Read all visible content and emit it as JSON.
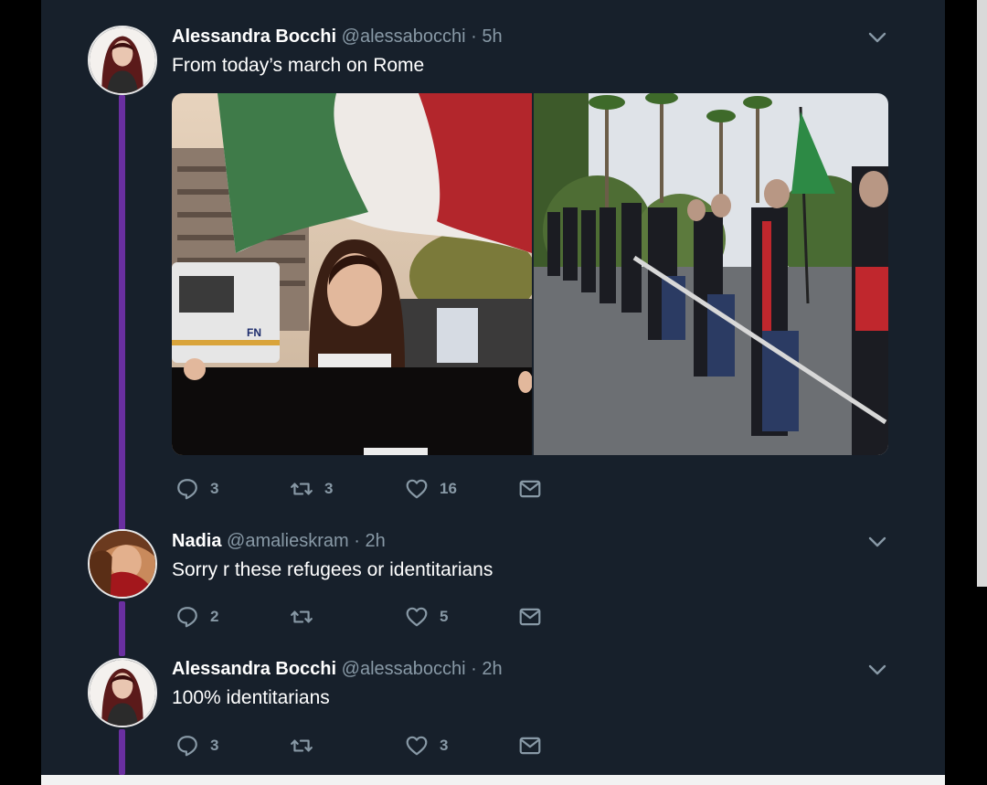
{
  "thread": [
    {
      "name": "Alessandra Bocchi",
      "handle": "@alessabocchi",
      "dot": "·",
      "time": "5h",
      "text": "From today’s march on Rome",
      "actions": {
        "reply": "3",
        "retweet": "3",
        "like": "16"
      }
    },
    {
      "name": "Nadia",
      "handle": "@amalieskram",
      "dot": "·",
      "time": "2h",
      "text": "Sorry r these refugees or identitarians",
      "actions": {
        "reply": "2",
        "retweet": "",
        "like": "5"
      }
    },
    {
      "name": "Alessandra Bocchi",
      "handle": "@alessabocchi",
      "dot": "·",
      "time": "2h",
      "text": "100% identitarians",
      "actions": {
        "reply": "3",
        "retweet": "",
        "like": "3"
      }
    }
  ],
  "media": {
    "photo1_sign_text": "FN"
  },
  "colors": {
    "background": "#17202b",
    "thread_line": "#6a2fa0",
    "muted": "#8899a6"
  }
}
